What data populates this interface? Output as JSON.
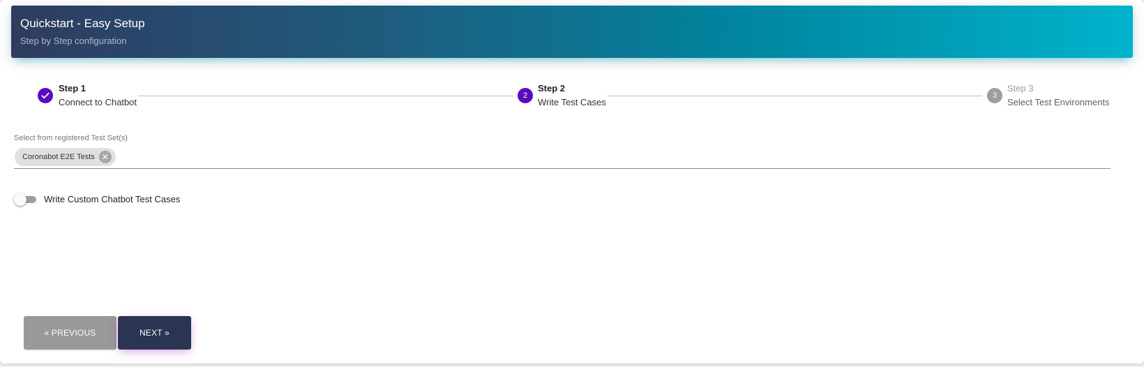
{
  "header": {
    "title": "Quickstart - Easy Setup",
    "subtitle": "Step by Step configuration"
  },
  "stepper": {
    "steps": [
      {
        "title": "Step 1",
        "label": "Connect to Chatbot",
        "state": "completed",
        "icon": "check-icon"
      },
      {
        "title": "Step 2",
        "label": "Write Test Cases",
        "state": "active",
        "number": "2"
      },
      {
        "title": "Step 3",
        "label": "Select Test Environments",
        "state": "pending",
        "number": "3"
      }
    ]
  },
  "test_set_field": {
    "label": "Select from registered Test Set(s)",
    "chips": [
      {
        "label": "Coronabot E2E Tests",
        "remove_icon": "close-circle-icon"
      }
    ]
  },
  "custom_toggle": {
    "label": "Write Custom Chatbot Test Cases",
    "checked": false
  },
  "buttons": {
    "previous": "« PREVIOUS",
    "next": "NEXT »"
  },
  "colors": {
    "header_gradient_start": "#2f3b5f",
    "header_gradient_end": "#00b3cc",
    "step_active": "#5b0ac0",
    "step_pending": "#9e9e9e",
    "next_button": "#2c3454",
    "previous_button": "#999999"
  }
}
